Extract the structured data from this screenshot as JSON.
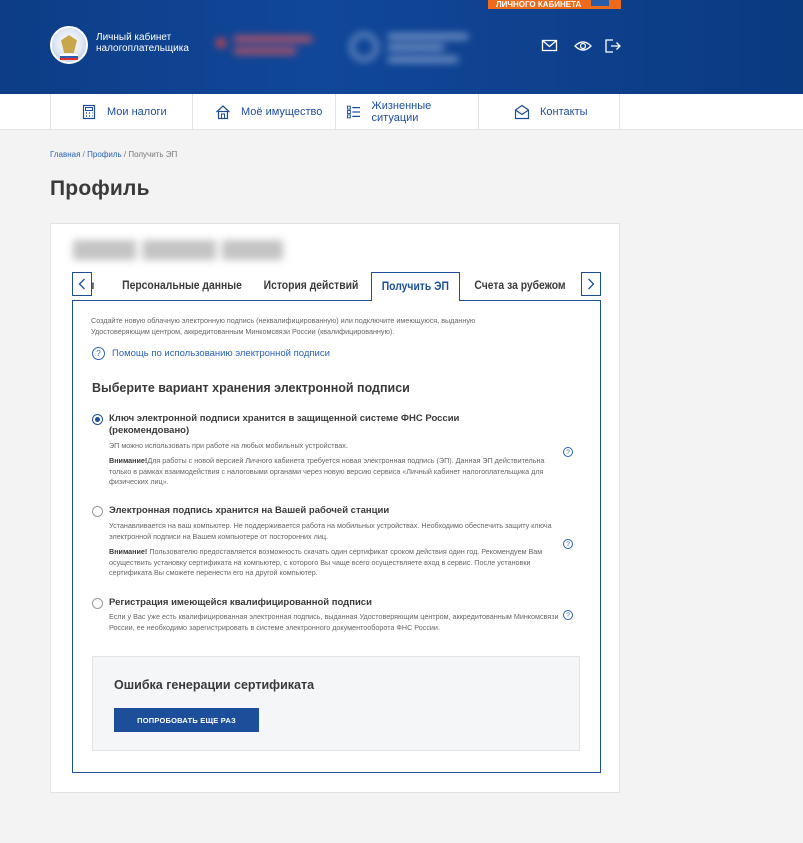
{
  "promo": {
    "text": "ЛИЧНОГО КАБИНЕТА"
  },
  "brand": {
    "line1": "Личный кабинет",
    "line2": "налогоплательщика"
  },
  "nav": [
    {
      "label": "Мои налоги",
      "icon": "calculator-icon"
    },
    {
      "label": "Моё имущество",
      "icon": "house-icon"
    },
    {
      "label": "Жизненные ситуации",
      "icon": "list-icon"
    },
    {
      "label": "Контакты",
      "icon": "envelope-icon"
    }
  ],
  "breadcrumb": {
    "home": "Главная",
    "profile": "Профиль",
    "current": "Получить ЭП"
  },
  "page": {
    "title": "Профиль"
  },
  "tabs": [
    {
      "label": "Персональные данные"
    },
    {
      "label": "История действий"
    },
    {
      "label": "Получить ЭП",
      "active": true
    },
    {
      "label": "Счета за рубежом"
    }
  ],
  "panel": {
    "intro_line1": "Создайте новую облачную электронную подпись (неквалифицированную) или подключите имеющуюся, выданную",
    "intro_line2": "Удостоверяющим центром, аккредитованным Минкомсвязи России (квалифицированную).",
    "help_link": "Помощь по использованию электронной подписи",
    "section_title": "Выберите вариант хранения электронной подписи",
    "options": [
      {
        "title": "Ключ электронной подписи хранится в защищенной системе ФНС России (рекомендовано)",
        "desc": "ЭП можно использовать при работе на любых мобильных устройствах.",
        "warn_label": "Внимание!",
        "warn_text": "Для работы с новой версией Личного кабинета требуется новая электронная подпись (ЭП). Данная ЭП действительна только в рамках взаимодействия с налоговыми органами через новую версию сервиса «Личный кабинет налогоплательщика для физических лиц».",
        "selected": true
      },
      {
        "title": "Электронная подпись хранится на Вашей рабочей станции",
        "desc": "Устанавливается на ваш компьютер. Не поддерживается работа на мобильных устройствах. Необходимо обеспечить защиту ключа электронной подписи на Вашем компьютере от посторонних лиц.",
        "warn_label": "Внимание!",
        "warn_text": " Пользователю предоставляется возможность скачать один сертификат  сроком действия один год. Рекомендуем Вам осуществить установку сертификата на компьютер, с которого Вы  чаще всего осуществляете вход в сервис. После установки сертификата Вы сможете перенести его на другой  компьютер.",
        "selected": false
      },
      {
        "title": "Регистрация имеющейся квалифицированной подписи",
        "desc": "Если у Вас уже есть квалифицированная электронная подпись, выданная Удостоверяющим центром, аккредитованным Минкомсвязи России, ее необходимо зарегистрировать в системе электронного документооборота ФНС России.",
        "selected": false
      }
    ],
    "error_title": "Ошибка генерации сертификата",
    "retry_button": "ПОПРОБОВАТЬ ЕЩЕ РАЗ"
  },
  "colors": {
    "brand_blue": "#1d4e9a",
    "header_blue": "#0c3d86",
    "promo_orange": "#f06a1c"
  }
}
